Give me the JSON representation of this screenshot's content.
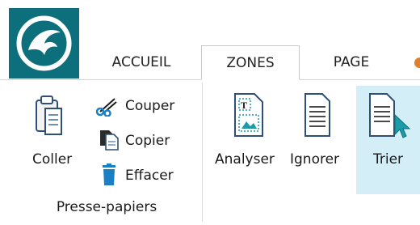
{
  "tabs": [
    {
      "label": "ACCUEIL",
      "active": false
    },
    {
      "label": "ZONES",
      "active": true
    },
    {
      "label": "PAGE",
      "active": false
    }
  ],
  "clipboard": {
    "group_label": "Presse-papiers",
    "coller": "Coller",
    "couper": "Couper",
    "copier": "Copier",
    "effacer": "Effacer"
  },
  "zones": {
    "analyser": "Analyser",
    "ignorer": "Ignorer",
    "trier": "Trier"
  },
  "colors": {
    "brand": "#0e6f7c",
    "hover": "#d3eef7",
    "accent_orange": "#e0802e"
  }
}
